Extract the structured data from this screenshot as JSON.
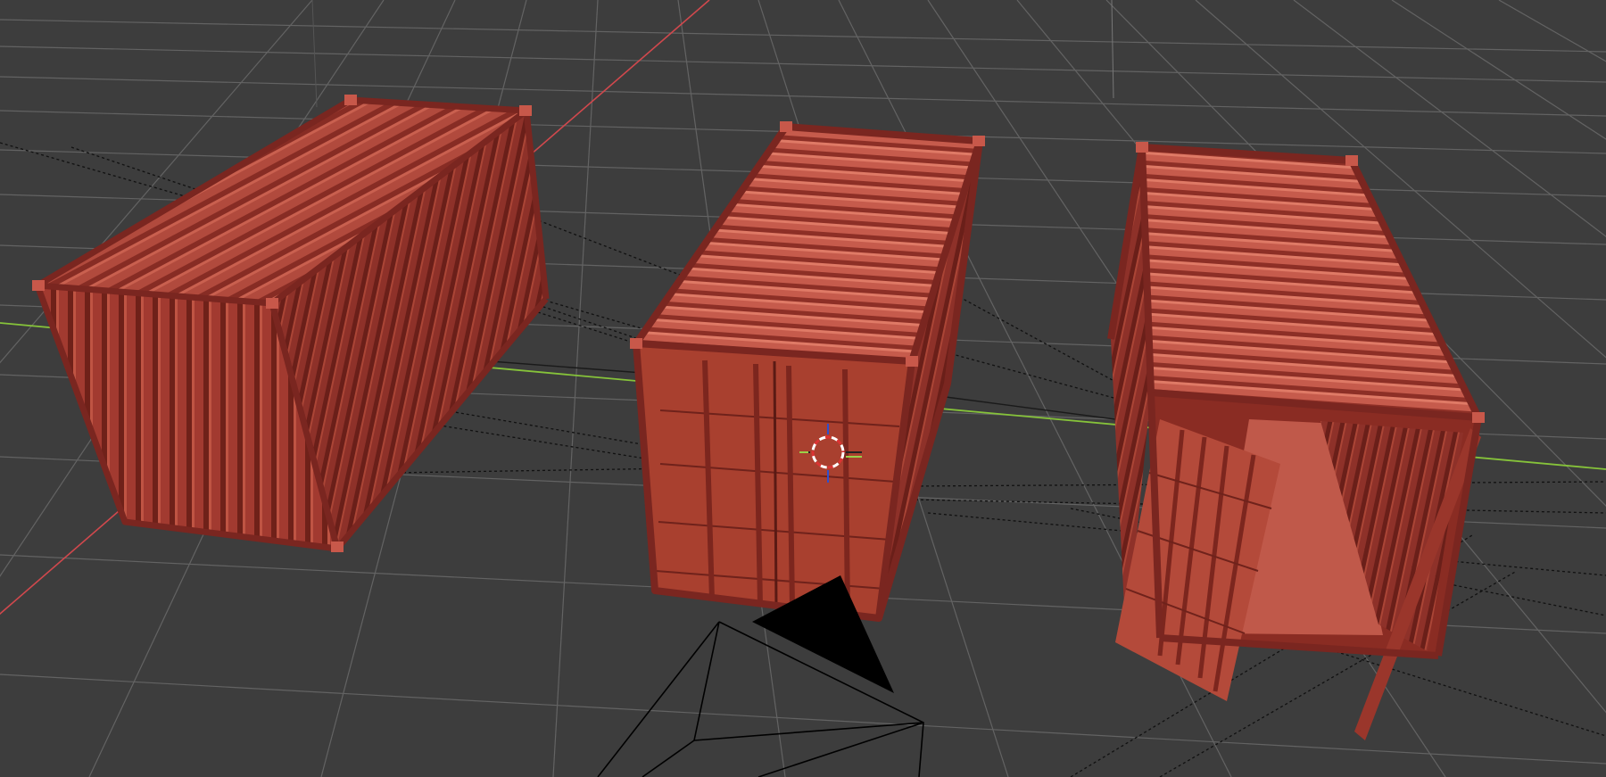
{
  "viewport": {
    "background": "#3d3d3d",
    "grid_color": "#6a6a6a",
    "x_axis_color": "#d0484d",
    "y_axis_color": "#86c33a",
    "container_color": "#a8392f"
  },
  "objects": [
    {
      "kind": "shipping-container",
      "state": "closed-side-view"
    },
    {
      "kind": "shipping-container",
      "state": "doors-closed"
    },
    {
      "kind": "shipping-container",
      "state": "doors-open"
    },
    {
      "kind": "camera",
      "state": "wireframe"
    },
    {
      "kind": "3d-cursor",
      "state": "active"
    }
  ]
}
